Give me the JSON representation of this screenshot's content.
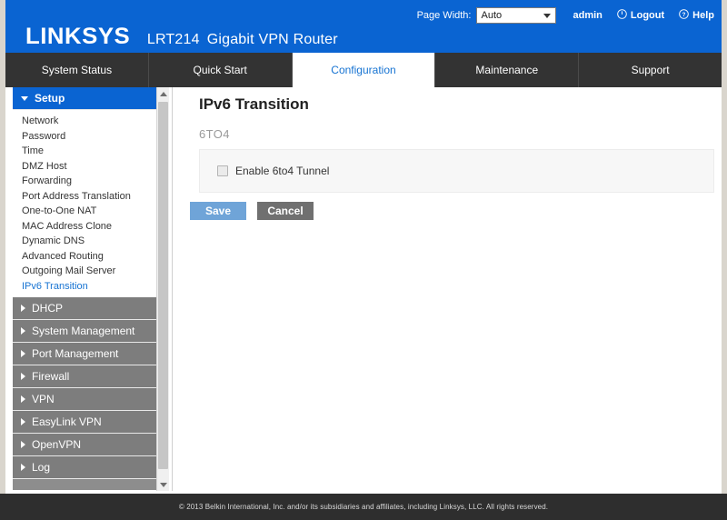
{
  "header": {
    "logo": "LINKSYS",
    "model": "LRT214",
    "description": "Gigabit VPN Router",
    "page_width_label": "Page Width:",
    "page_width_value": "Auto",
    "page_width_options": [
      "Auto"
    ],
    "user": "admin",
    "logout": "Logout",
    "help": "Help",
    "logout_icon": "power-icon",
    "help_icon": "question-circle-icon",
    "brand_color": "#0a64d2"
  },
  "nav": {
    "tabs": [
      {
        "label": "System Status",
        "active": false
      },
      {
        "label": "Quick Start",
        "active": false
      },
      {
        "label": "Configuration",
        "active": true
      },
      {
        "label": "Maintenance",
        "active": false
      },
      {
        "label": "Support",
        "active": false
      }
    ],
    "active_color": "#1673d2",
    "bar_color": "#333333"
  },
  "sidebar": {
    "sections": [
      {
        "label": "Setup",
        "expanded": true,
        "icon": "chevron-down-icon",
        "items": [
          {
            "label": "Network",
            "selected": false
          },
          {
            "label": "Password",
            "selected": false
          },
          {
            "label": "Time",
            "selected": false
          },
          {
            "label": "DMZ Host",
            "selected": false
          },
          {
            "label": "Forwarding",
            "selected": false
          },
          {
            "label": "Port Address Translation",
            "selected": false
          },
          {
            "label": "One-to-One NAT",
            "selected": false
          },
          {
            "label": "MAC Address Clone",
            "selected": false
          },
          {
            "label": "Dynamic DNS",
            "selected": false
          },
          {
            "label": "Advanced Routing",
            "selected": false
          },
          {
            "label": "Outgoing Mail Server",
            "selected": false
          },
          {
            "label": "IPv6 Transition",
            "selected": true
          }
        ]
      },
      {
        "label": "DHCP",
        "expanded": false,
        "icon": "chevron-right-icon",
        "items": []
      },
      {
        "label": "System Management",
        "expanded": false,
        "icon": "chevron-right-icon",
        "items": []
      },
      {
        "label": "Port Management",
        "expanded": false,
        "icon": "chevron-right-icon",
        "items": []
      },
      {
        "label": "Firewall",
        "expanded": false,
        "icon": "chevron-right-icon",
        "items": []
      },
      {
        "label": "VPN",
        "expanded": false,
        "icon": "chevron-right-icon",
        "items": []
      },
      {
        "label": "EasyLink VPN",
        "expanded": false,
        "icon": "chevron-right-icon",
        "items": []
      },
      {
        "label": "OpenVPN",
        "expanded": false,
        "icon": "chevron-right-icon",
        "items": []
      },
      {
        "label": "Log",
        "expanded": false,
        "icon": "chevron-right-icon",
        "items": []
      }
    ],
    "selected_color": "#1673d2",
    "section_color": "#7d7d7d"
  },
  "main": {
    "title": "IPv6 Transition",
    "section_label": "6TO4",
    "checkbox": {
      "label": "Enable 6to4 Tunnel",
      "checked": false
    },
    "save_label": "Save",
    "cancel_label": "Cancel",
    "save_color": "#6fa4d8",
    "cancel_color": "#707070"
  },
  "footer": {
    "copyright": "© 2013 Belkin International, Inc. and/or its subsidiaries and affiliates, including Linksys, LLC. All rights reserved."
  }
}
